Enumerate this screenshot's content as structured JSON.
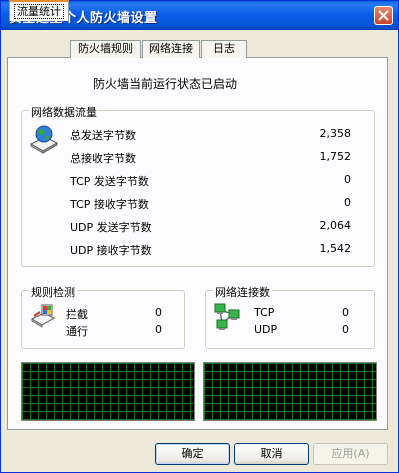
{
  "window": {
    "title": "安全之星个人防火墙设置"
  },
  "tabs": [
    {
      "label": "流量统计",
      "active": true
    },
    {
      "label": "防火墙规则",
      "active": false
    },
    {
      "label": "网络连接",
      "active": false
    },
    {
      "label": "日志",
      "active": false
    }
  ],
  "status": "防火墙当前运行状态已启动",
  "traffic": {
    "title": "网络数据流量",
    "icon": "network-globe-icon",
    "rows": [
      {
        "label": "总发送字节数",
        "value": "2,358"
      },
      {
        "label": "总接收字节数",
        "value": "1,752"
      },
      {
        "label": "TCP 发送字节数",
        "value": "0"
      },
      {
        "label": "TCP 接收字节数",
        "value": "0"
      },
      {
        "label": "UDP 发送字节数",
        "value": "2,064"
      },
      {
        "label": "UDP 接收字节数",
        "value": "1,542"
      }
    ]
  },
  "rules": {
    "title": "规则检测",
    "icon": "rule-check-icon",
    "rows": [
      {
        "label": "拦截",
        "value": "0"
      },
      {
        "label": "通行",
        "value": "0"
      }
    ]
  },
  "connections": {
    "title": "网络连接数",
    "icon": "network-nodes-icon",
    "rows": [
      {
        "label": "TCP",
        "value": "0"
      },
      {
        "label": "UDP",
        "value": "0"
      }
    ]
  },
  "buttons": {
    "ok": "确定",
    "cancel": "取消",
    "apply": "应用(A)"
  },
  "colors": {
    "title_bar": "#0a5de8",
    "monitor_grid": "#0a7a1a",
    "monitor_bg": "#000000",
    "tab_highlight": "#e68b2c"
  }
}
